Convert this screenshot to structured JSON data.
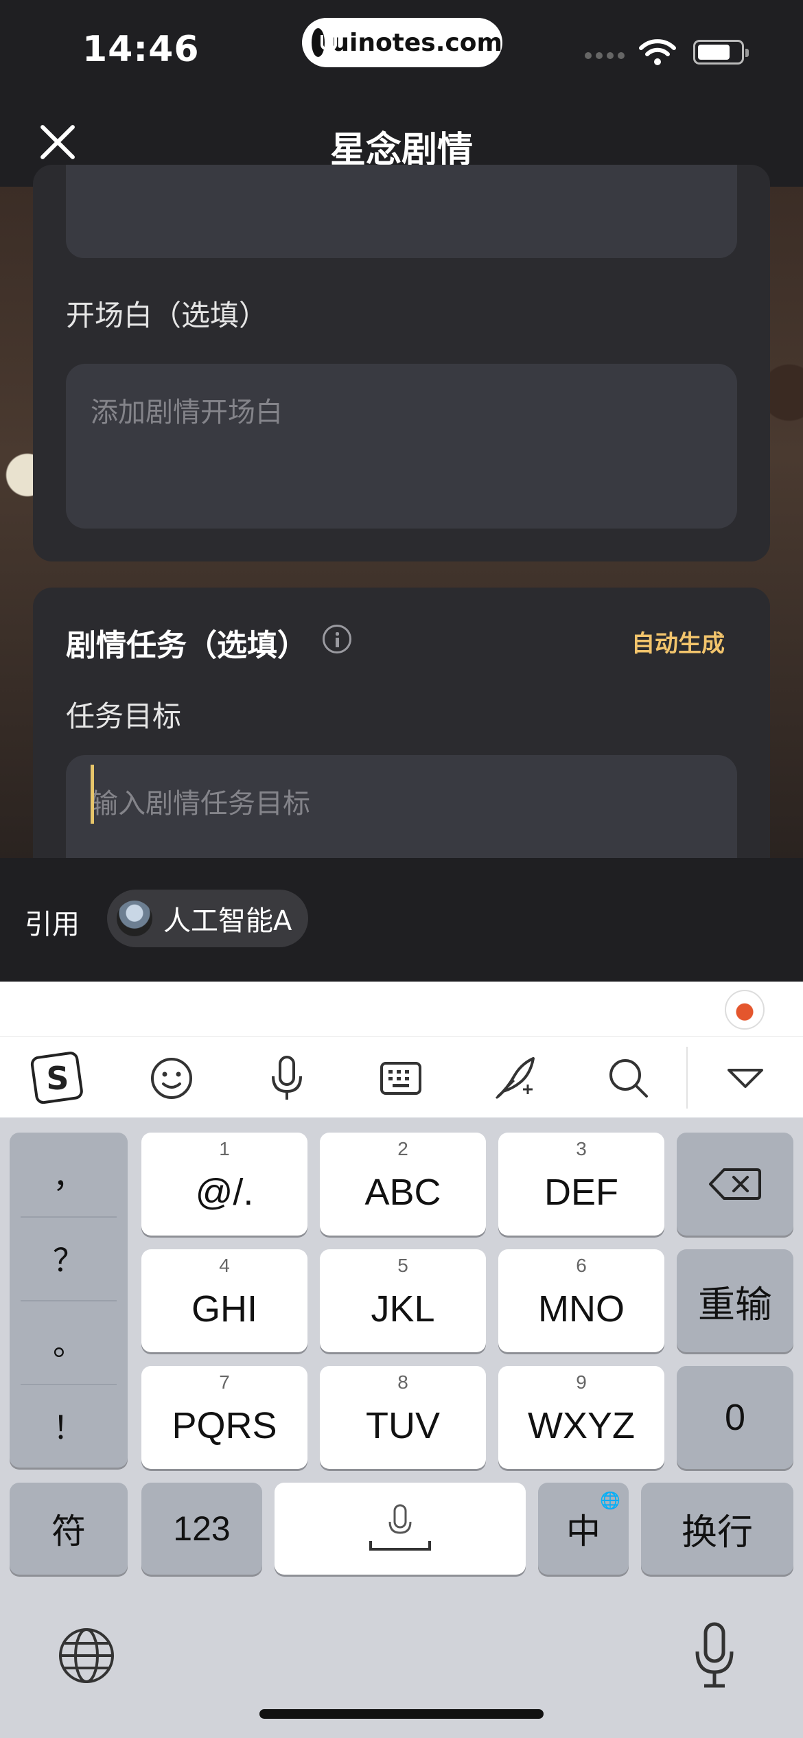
{
  "status_bar": {
    "time": "14:46",
    "url": "uinotes.com",
    "icons": [
      "signal-icon",
      "wifi-icon",
      "battery-icon"
    ]
  },
  "header": {
    "title": "星念剧情",
    "close_icon": "close-icon"
  },
  "opening_section": {
    "label": "开场白（选填）",
    "placeholder": "添加剧情开场白"
  },
  "task_section": {
    "title": "剧情任务（选填）",
    "info_icon": "info-icon",
    "auto_generate": "自动生成",
    "goal_label": "任务目标",
    "goal_placeholder": "输入剧情任务目标"
  },
  "reference": {
    "label": "引用",
    "chip_text": "人工智能A"
  },
  "keyboard": {
    "toolbar_icons": [
      "sogou-logo-icon",
      "emoji-icon",
      "voice-icon",
      "keyboard-icon",
      "handwriting-icon",
      "search-icon",
      "collapse-icon"
    ],
    "punctuation": [
      "，",
      "？",
      "。",
      "！"
    ],
    "keys": [
      {
        "num": "1",
        "label": "@/."
      },
      {
        "num": "2",
        "label": "ABC"
      },
      {
        "num": "3",
        "label": "DEF"
      },
      {
        "num": "4",
        "label": "GHI"
      },
      {
        "num": "5",
        "label": "JKL"
      },
      {
        "num": "6",
        "label": "MNO"
      },
      {
        "num": "7",
        "label": "PQRS"
      },
      {
        "num": "8",
        "label": "TUV"
      },
      {
        "num": "9",
        "label": "WXYZ"
      }
    ],
    "retype": "重输",
    "zero": "0",
    "symbols": "符",
    "num_mode": "123",
    "lang": "中",
    "enter": "换行"
  },
  "colors": {
    "accent": "#f2c46c",
    "surface": "#2b2b2f",
    "field": "#393a41"
  }
}
